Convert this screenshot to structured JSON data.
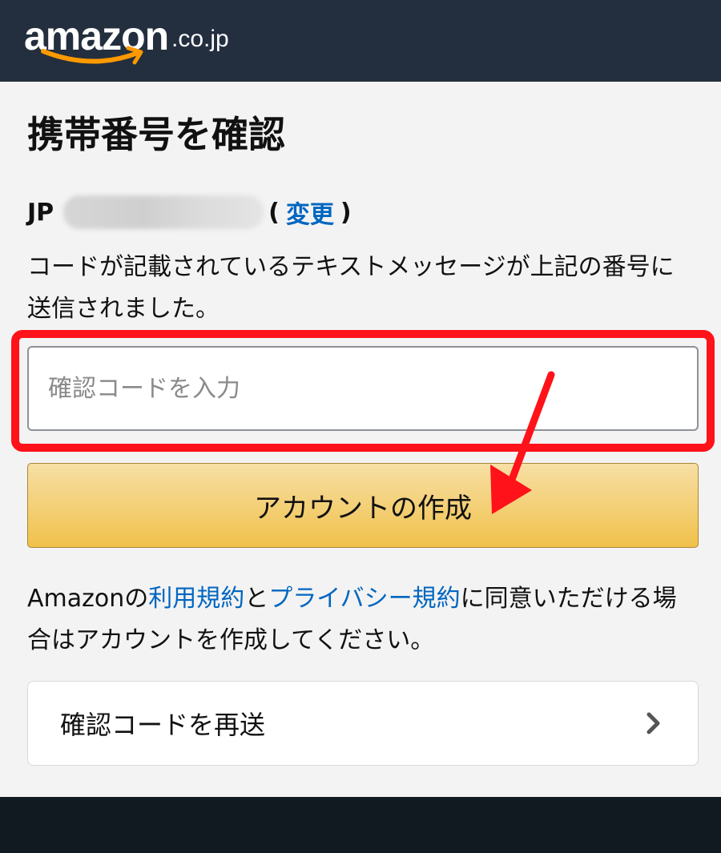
{
  "header": {
    "logo_word": "amazon",
    "logo_tld": ".co.jp",
    "smile_color": "#ff9900",
    "bg_color": "#232f3e"
  },
  "page": {
    "title": "携帯番号を確認",
    "phone": {
      "country_code": "JP",
      "open_paren": "(",
      "change_link": "変更",
      "close_paren": ")"
    },
    "description": "コードが記載されているテキストメッセージが上記の番号に送信されました。",
    "code_input": {
      "placeholder": "確認コードを入力",
      "value": ""
    },
    "create_button": "アカウントの作成",
    "terms": {
      "prefix": "Amazonの",
      "link_terms": "利用規約",
      "middle": "と",
      "link_privacy": "プライバシー規約",
      "suffix": "に同意いただける場合はアカウントを作成してください。"
    },
    "resend": {
      "label": "確認コードを再送",
      "icon": "chevron-right-icon"
    }
  },
  "annotations": {
    "highlight_color": "#ff1219",
    "arrow_color": "#ff1219"
  },
  "colors": {
    "link": "#0066c0",
    "button_top": "#f7dfa5",
    "button_bottom": "#f0c14b",
    "footer": "#111921"
  }
}
